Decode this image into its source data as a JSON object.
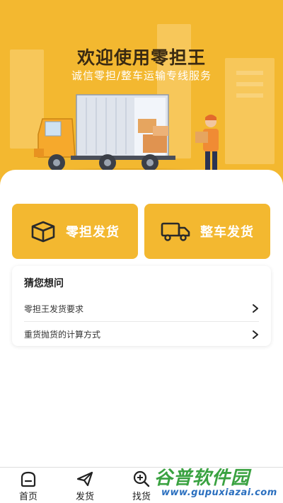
{
  "hero": {
    "title": "欢迎使用零担王",
    "subtitle": "诚信零担/整车运输专线服务"
  },
  "actions": {
    "ld_label": "零担发货",
    "zc_label": "整车发货"
  },
  "faq": {
    "title": "猜您想问",
    "items": [
      {
        "text": "零担王发货要求",
        "icon": "chevron-right-icon"
      },
      {
        "text": "重货抛货的计算方式",
        "icon": "chevron-right-icon"
      }
    ]
  },
  "tabbar": {
    "tabs": [
      {
        "label": "首页",
        "icon": "home-icon"
      },
      {
        "label": "发货",
        "icon": "send-icon"
      },
      {
        "label": "找货",
        "icon": "search-plus-icon"
      }
    ]
  },
  "watermark": {
    "main": "谷普软件园",
    "url": "www.gupuxiazai.com"
  },
  "colors": {
    "accent": "#f3b830",
    "title_text": "#3a2a12"
  }
}
